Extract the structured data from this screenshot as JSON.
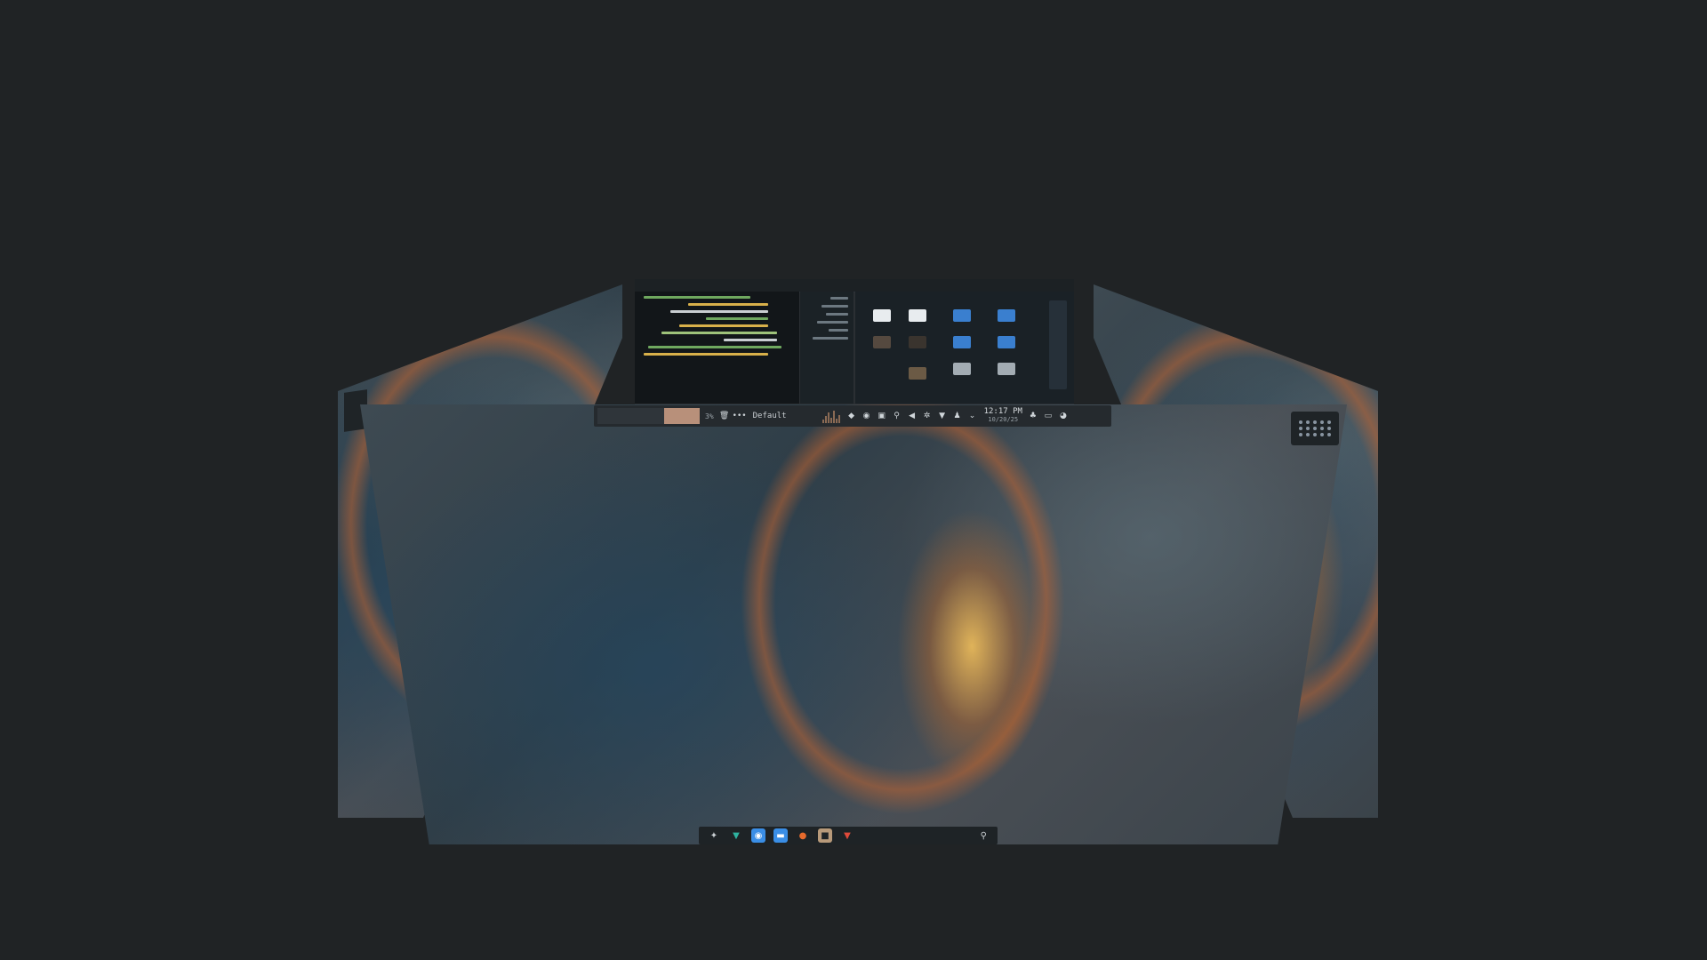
{
  "top_panel": {
    "workspace_percent": "3%",
    "workspace_name": "Default",
    "clock_time": "12:17 PM",
    "clock_date": "10/20/25",
    "icons": [
      "trash-icon",
      "dots-icon",
      "bell-icon",
      "record-icon",
      "clipboard-icon",
      "search-icon",
      "volume-icon",
      "settings-icon",
      "wifi-icon",
      "user-icon",
      "chevron-down-icon",
      "notification-icon",
      "screen-icon",
      "palette-icon"
    ]
  },
  "dock": {
    "apps": [
      {
        "name": "launcher-icon",
        "glyph": "✦",
        "color": "#c9ced2"
      },
      {
        "name": "store-icon",
        "glyph": "▼",
        "color": "#2fb3a0"
      },
      {
        "name": "camera-icon",
        "glyph": "◉",
        "color": "#3a8ee6"
      },
      {
        "name": "files-icon",
        "glyph": "▬",
        "color": "#3a8ee6"
      },
      {
        "name": "firefox-icon",
        "glyph": "●",
        "color": "#e66a2c"
      },
      {
        "name": "terminal-icon",
        "glyph": "■",
        "color": "#b89a7a"
      },
      {
        "name": "brave-icon",
        "glyph": "▼",
        "color": "#e04a3a"
      }
    ]
  },
  "colors": {
    "background": "#202325",
    "panel": "#252a2e",
    "accent": "#b8907a"
  }
}
